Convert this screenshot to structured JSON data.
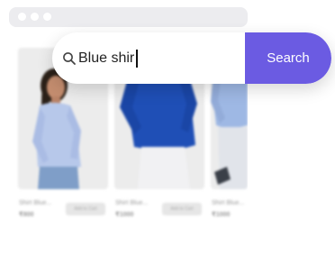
{
  "search": {
    "value": "Blue shir",
    "button_label": "Search"
  },
  "products": [
    {
      "name": "Shirt Blue...",
      "price": "₹800",
      "cart_label": "Add to Cart"
    },
    {
      "name": "Shirt Blue...",
      "price": "₹1000",
      "cart_label": "Add to Cart"
    },
    {
      "name": "Shirt Blue...",
      "price": "₹1000"
    }
  ],
  "colors": {
    "accent": "#6b5be2",
    "titlebar": "#ececef",
    "shirt_light_blue": "#b7c8ea",
    "shirt_royal_blue": "#1f4fb6"
  },
  "icons": {
    "search": "search-icon",
    "window_controls": "window-dot-icon"
  }
}
